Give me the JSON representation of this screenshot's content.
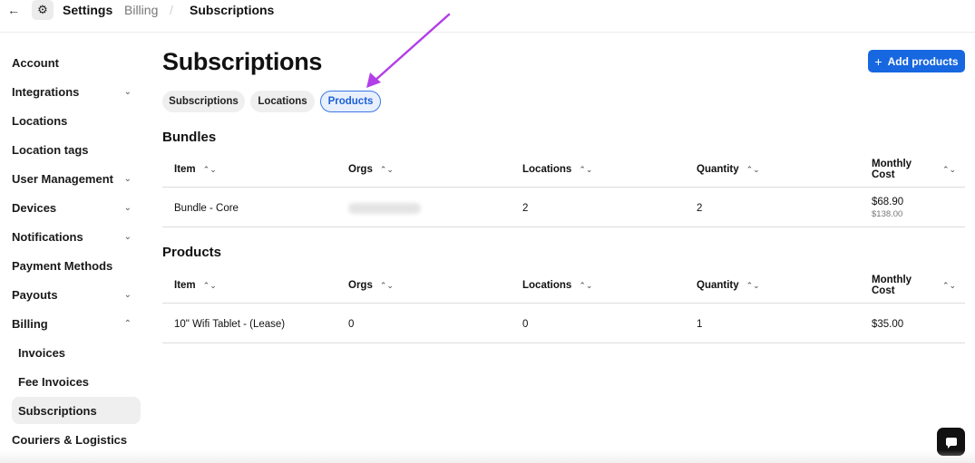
{
  "topbar": {
    "back_icon": "←",
    "gear_icon": "⚙",
    "settings": "Settings",
    "billing": "Billing",
    "separator": "/",
    "current": "Subscriptions"
  },
  "sidebar": {
    "items": [
      {
        "label": "Account",
        "chevron": ""
      },
      {
        "label": "Integrations",
        "chevron": "⌄"
      },
      {
        "label": "Locations",
        "chevron": ""
      },
      {
        "label": "Location tags",
        "chevron": ""
      },
      {
        "label": "User Management",
        "chevron": "⌄"
      },
      {
        "label": "Devices",
        "chevron": "⌄"
      },
      {
        "label": "Notifications",
        "chevron": "⌄"
      },
      {
        "label": "Payment Methods",
        "chevron": ""
      },
      {
        "label": "Payouts",
        "chevron": "⌄"
      },
      {
        "label": "Billing",
        "chevron": "⌃"
      },
      {
        "label": "Invoices",
        "chevron": ""
      },
      {
        "label": "Fee Invoices",
        "chevron": ""
      },
      {
        "label": "Subscriptions",
        "chevron": ""
      },
      {
        "label": "Couriers & Logistics",
        "chevron": ""
      }
    ]
  },
  "main": {
    "title": "Subscriptions",
    "add_button": {
      "icon": "+",
      "label": "Add products"
    },
    "tabs": [
      "Subscriptions",
      "Locations",
      "Products"
    ],
    "active_tab": "Products"
  },
  "table_headers": {
    "item": "Item",
    "orgs": "Orgs",
    "locations": "Locations",
    "quantity": "Quantity",
    "monthly_cost": "Monthly Cost",
    "sort_icon": "⌃⌄"
  },
  "bundles": {
    "title": "Bundles",
    "rows": [
      {
        "item": "Bundle - Core",
        "orgs": "",
        "locations": "2",
        "quantity": "2",
        "cost": "$68.90",
        "old_cost": "$138.00"
      }
    ]
  },
  "products": {
    "title": "Products",
    "rows": [
      {
        "item": "10\" Wifi Tablet - (Lease)",
        "orgs": "0",
        "locations": "0",
        "quantity": "1",
        "cost": "$35.00"
      }
    ]
  },
  "colors": {
    "accent": "#1767e0",
    "annotation_arrow": "#b23ee8"
  }
}
